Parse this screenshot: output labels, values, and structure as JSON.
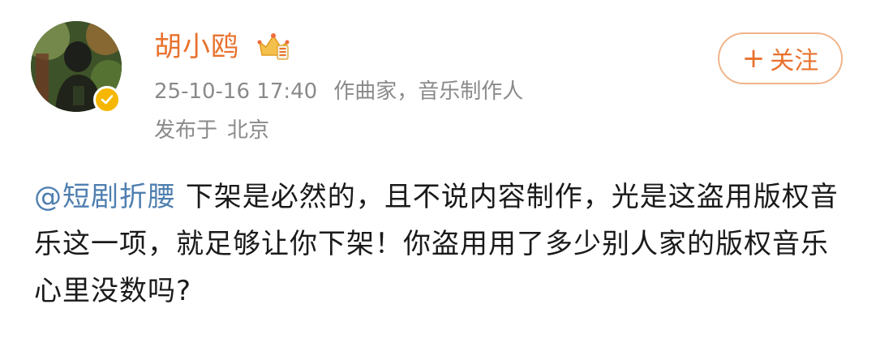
{
  "user": {
    "name": "胡小鸥",
    "vip_icon": "crown-vip-icon",
    "verified_icon": "verified-check-icon"
  },
  "meta": {
    "timestamp": "25-10-16 17:40",
    "title": "作曲家，音乐制作人",
    "location_prefix": "发布于",
    "location": "北京"
  },
  "follow_button": {
    "plus": "+",
    "label": "关注"
  },
  "post": {
    "mention": "@短剧折腰",
    "text": " 下架是必然的，且不说内容制作，光是这盗用版权音乐这一项，就足够让你下架！你盗用用了多少别人家的版权音乐心里没数吗?"
  },
  "colors": {
    "name": "#e8722e",
    "meta": "#8a8a8a",
    "mention": "#4f7fb0",
    "text": "#1a1a1a",
    "follow_border": "#f0b48a",
    "badge": "#f6b700"
  }
}
